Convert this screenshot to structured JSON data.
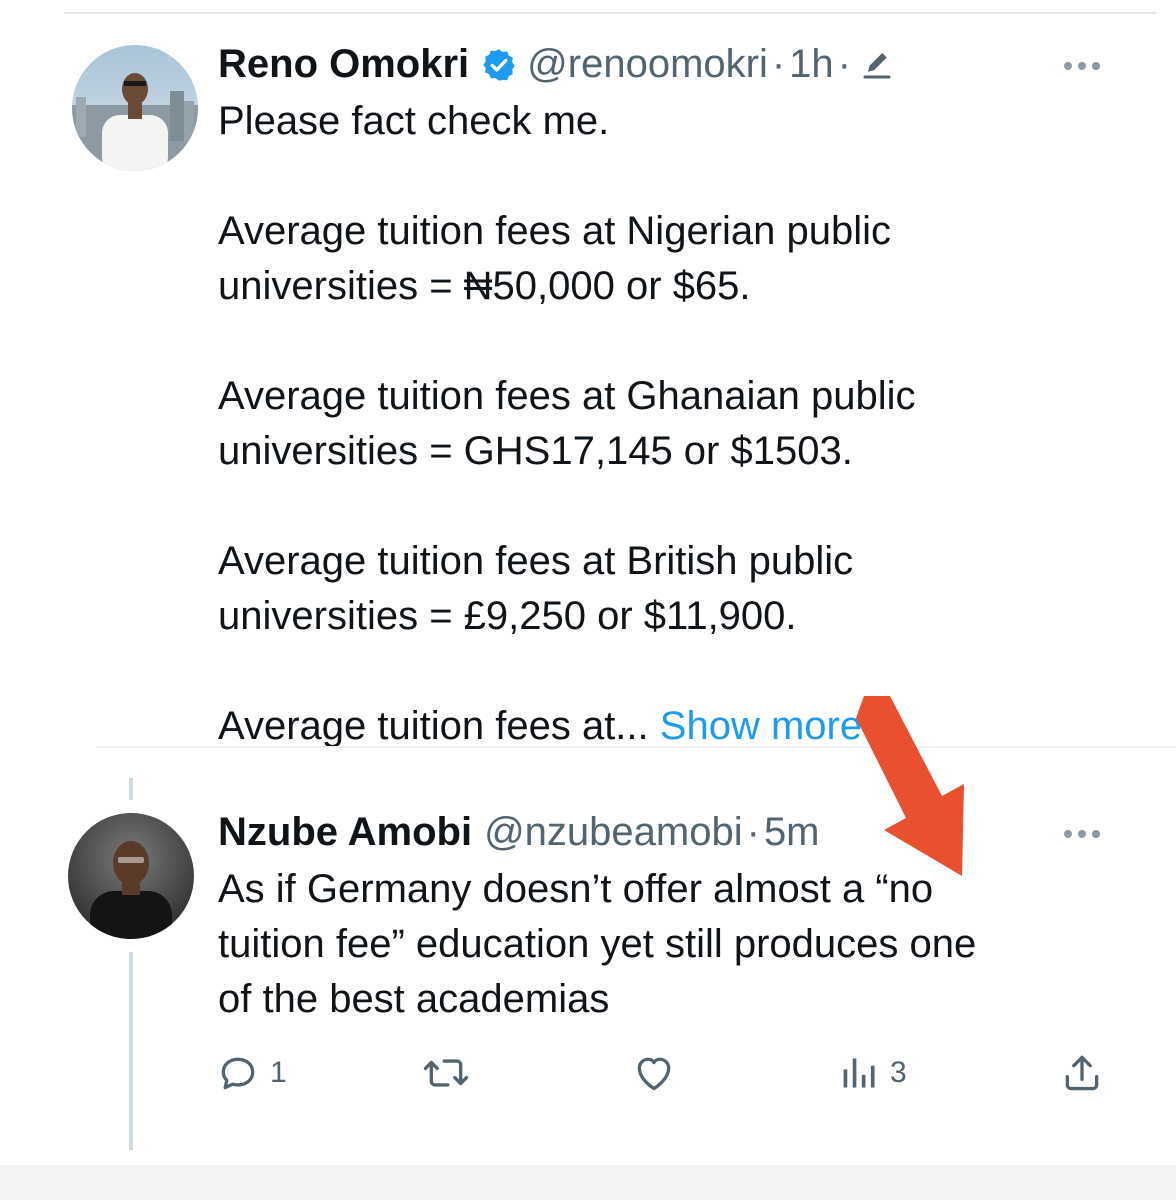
{
  "tweets": [
    {
      "display_name": "Reno Omokri",
      "handle": "@renoomokri",
      "separator": "·",
      "time": "1h",
      "verified": true,
      "edited": true,
      "text_lines": [
        "Please fact check me.",
        "",
        "Average tuition fees at Nigerian public",
        "universities = ₦50,000 or $65.",
        "",
        "Average tuition fees at Ghanaian public",
        "universities = GHS17,145 or $1503.",
        "",
        "Average tuition fees at British public",
        "universities = £9,250 or $11,900.",
        "",
        "Average tuition fees at..."
      ],
      "show_more_label": "Show more",
      "icons": [
        "verified-badge-icon",
        "edit-icon",
        "more-options-icon"
      ]
    },
    {
      "display_name": "Nzube Amobi",
      "handle": "@nzubeamobi",
      "separator": "·",
      "time": "5m",
      "text_lines": [
        "As if Germany doesn’t offer almost a “no",
        "tuition fee” education yet still produces one",
        "of the best academias"
      ],
      "actions": {
        "reply_count": "1",
        "retweet_count": "",
        "like_count": "",
        "views_count": "3"
      },
      "icons": [
        "reply-icon",
        "retweet-icon",
        "like-icon",
        "views-icon",
        "share-icon",
        "more-options-icon"
      ]
    }
  ],
  "annotation": {
    "arrow_color": "#e8502f"
  },
  "colors": {
    "text": "#0f1419",
    "secondary": "#536471",
    "link": "#1d9bf0",
    "verified": "#1d9bf0"
  }
}
